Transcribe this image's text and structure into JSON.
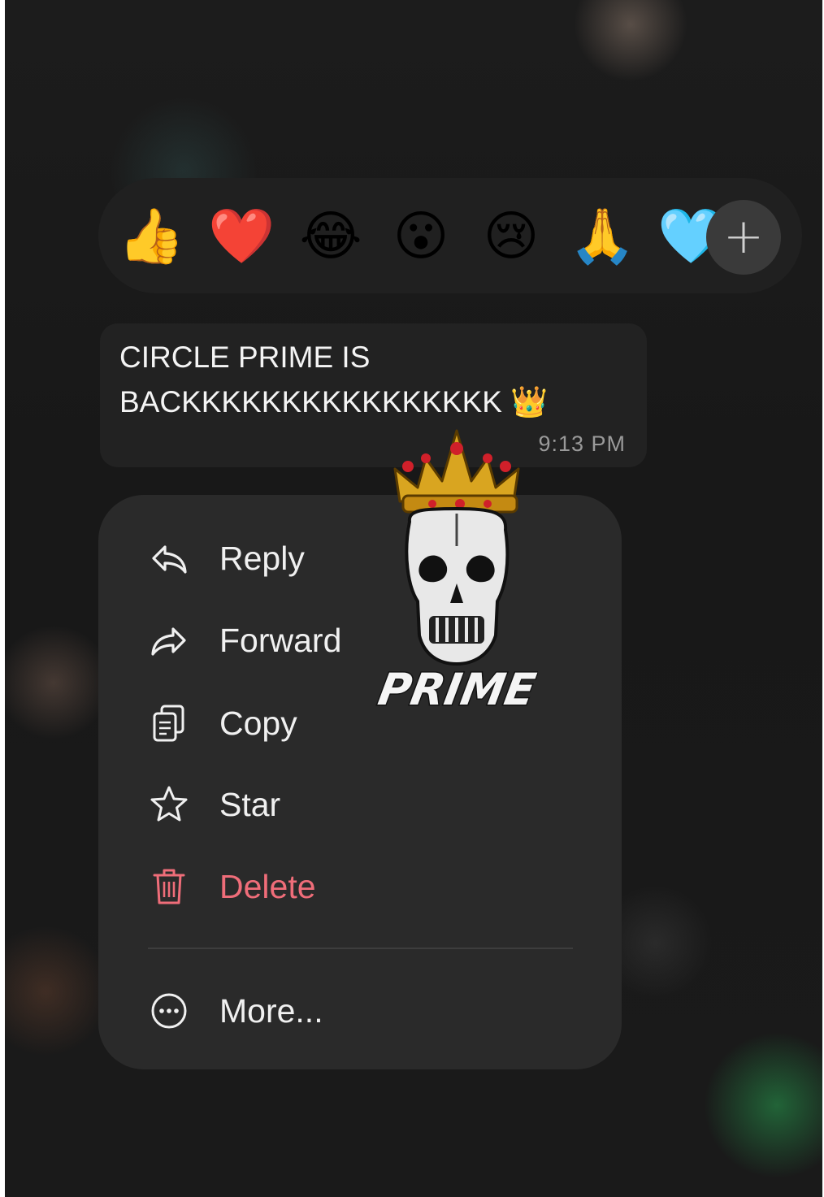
{
  "reactions": [
    {
      "emoji": "👍",
      "name": "thumbs-up"
    },
    {
      "emoji": "❤️",
      "name": "red-heart"
    },
    {
      "emoji": "😂",
      "name": "face-with-tears-of-joy"
    },
    {
      "emoji": "😮",
      "name": "face-with-open-mouth"
    },
    {
      "emoji": "😢",
      "name": "crying-face"
    },
    {
      "emoji": "🙏",
      "name": "folded-hands"
    },
    {
      "emoji": "🩵",
      "name": "light-blue-heart"
    }
  ],
  "add_reaction": {
    "symbol": "+",
    "icon": "plus-icon"
  },
  "message": {
    "line1": "CIRCLE PRIME IS",
    "line2": "BACKKKKKKKKKKKKKKKK 👑",
    "time": "9:13 PM"
  },
  "menu": {
    "reply": "Reply",
    "forward": "Forward",
    "copy": "Copy",
    "star": "Star",
    "delete": "Delete",
    "more": "More..."
  },
  "sticker": {
    "text": "PRIME"
  },
  "colors": {
    "menu_bg": "#2a2a2a",
    "bubble_bg": "#222222",
    "delete_red": "#ef6d79",
    "text": "#f0f0f0",
    "timestamp": "#9a9a9a"
  }
}
